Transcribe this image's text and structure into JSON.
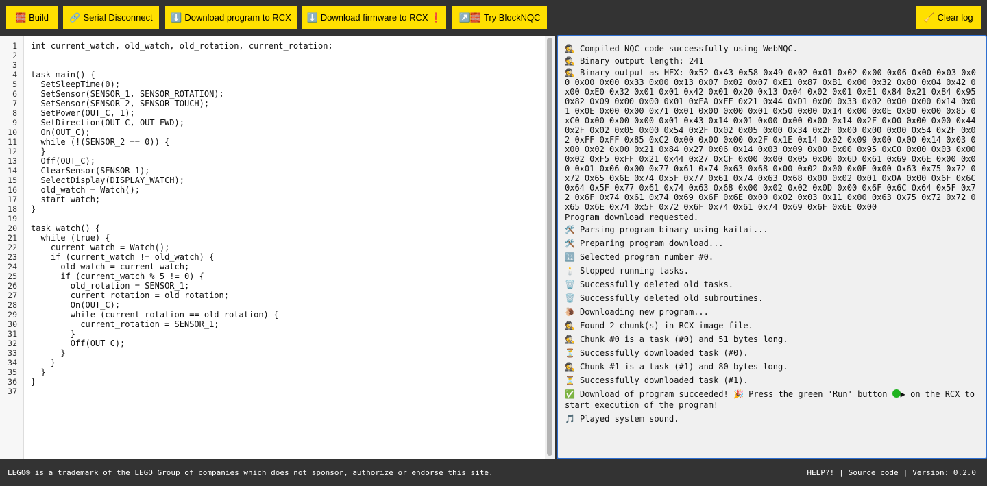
{
  "toolbar": {
    "build": {
      "icon": "🧱",
      "label": "Build"
    },
    "serial": {
      "icon": "🔗",
      "label": "Serial Disconnect"
    },
    "download_program": {
      "icon": "⬇️",
      "label": "Download program to RCX"
    },
    "download_firmware": {
      "icon": "⬇️",
      "label": "Download firmware to RCX ❗"
    },
    "try_blocknqc": {
      "icon": "↗️🧱",
      "label": "Try BlockNQC"
    },
    "clear_log": {
      "icon": "🧹",
      "label": "Clear log"
    },
    "button_color": "#ffe000"
  },
  "editor": {
    "line_numbers": [
      "1",
      "2",
      "3",
      "4",
      "5",
      "6",
      "7",
      "8",
      "9",
      "10",
      "11",
      "12",
      "13",
      "14",
      "15",
      "16",
      "17",
      "18",
      "19",
      "20",
      "21",
      "22",
      "23",
      "24",
      "25",
      "26",
      "27",
      "28",
      "29",
      "30",
      "31",
      "32",
      "33",
      "34",
      "35",
      "36",
      "37"
    ],
    "lines": [
      "int current_watch, old_watch, old_rotation, current_rotation;",
      "",
      "",
      "task main() {",
      "  SetSleepTime(0);",
      "  SetSensor(SENSOR_1, SENSOR_ROTATION);",
      "  SetSensor(SENSOR_2, SENSOR_TOUCH);",
      "  SetPower(OUT_C, 1);",
      "  SetDirection(OUT_C, OUT_FWD);",
      "  On(OUT_C);",
      "  while (!(SENSOR_2 == 0)) {",
      "  }",
      "  Off(OUT_C);",
      "  ClearSensor(SENSOR_1);",
      "  SelectDisplay(DISPLAY_WATCH);",
      "  old_watch = Watch();",
      "  start watch;",
      "}",
      "",
      "task watch() {",
      "  while (true) {",
      "    current_watch = Watch();",
      "    if (current_watch != old_watch) {",
      "      old_watch = current_watch;",
      "      if (current_watch % 5 != 0) {",
      "        old_rotation = SENSOR_1;",
      "        current_rotation = old_rotation;",
      "        On(OUT_C);",
      "        while (current_rotation == old_rotation) {",
      "          current_rotation = SENSOR_1;",
      "        }",
      "        Off(OUT_C);",
      "      }",
      "    }",
      "  }",
      "}",
      ""
    ]
  },
  "log": {
    "compiled": {
      "icon": "🕵️",
      "text": "Compiled NQC code successfully using WebNQC."
    },
    "binary_length": {
      "icon": "🕵️",
      "text": "Binary output length: 241"
    },
    "binary_hex": {
      "icon": "🕵️",
      "text": "Binary output as HEX: 0x52 0x43 0x58 0x49 0x02 0x01 0x02 0x00 0x06 0x00 0x03 0x00 0x00 0x00 0x33 0x00 0x13 0x07 0x02 0x07 0xE1 0x87 0xB1 0x00 0x32 0x00 0x04 0x42 0x00 0xE0 0x32 0x01 0x01 0x42 0x01 0x20 0x13 0x04 0x02 0x01 0xE1 0x84 0x21 0x84 0x95 0x82 0x09 0x00 0x00 0x01 0xFA 0xFF 0x21 0x44 0xD1 0x00 0x33 0x02 0x00 0x00 0x14 0x01 0x0E 0x00 0x00 0x71 0x01 0x00 0x00 0x01 0x50 0x00 0x14 0x00 0x0E 0x00 0x00 0x85 0xC0 0x00 0x00 0x00 0x01 0x43 0x14 0x01 0x00 0x00 0x00 0x14 0x2F 0x00 0x00 0x00 0x44 0x2F 0x02 0x05 0x00 0x54 0x2F 0x02 0x05 0x00 0x34 0x2F 0x00 0x00 0x00 0x54 0x2F 0x02 0xFF 0xFF 0x85 0xC2 0x00 0x00 0x00 0x2F 0x1E 0x14 0x02 0x09 0x00 0x00 0x14 0x03 0x00 0x02 0x00 0x21 0x84 0x27 0x06 0x14 0x03 0x09 0x00 0x00 0x95 0xC0 0x00 0x03 0x00 0x02 0xF5 0xFF 0x21 0x44 0x27 0xCF 0x00 0x00 0x05 0x00 0x6D 0x61 0x69 0x6E 0x00 0x00 0x01 0x06 0x00 0x77 0x61 0x74 0x63 0x68 0x00 0x02 0x00 0x0E 0x00 0x63 0x75 0x72 0x72 0x65 0x6E 0x74 0x5F 0x77 0x61 0x74 0x63 0x68 0x00 0x02 0x01 0x0A 0x00 0x6F 0x6C 0x64 0x5F 0x77 0x61 0x74 0x63 0x68 0x00 0x02 0x02 0x0D 0x00 0x6F 0x6C 0x64 0x5F 0x72 0x6F 0x74 0x61 0x74 0x69 0x6F 0x6E 0x00 0x02 0x03 0x11 0x00 0x63 0x75 0x72 0x72 0x65 0x6E 0x74 0x5F 0x72 0x6F 0x74 0x61 0x74 0x69 0x6F 0x6E 0x00"
    },
    "requested": {
      "text": "Program download requested."
    },
    "parsing": {
      "icon": "🛠️",
      "text": "Parsing program binary using kaitai..."
    },
    "preparing": {
      "icon": "🛠️",
      "text": "Preparing program download..."
    },
    "selected": {
      "icon": "🔢",
      "text": "Selected program number #0."
    },
    "stopped": {
      "icon": "🕯️",
      "text": "Stopped running tasks."
    },
    "deleted_tasks": {
      "icon": "🗑️",
      "text": "Successfully deleted old tasks."
    },
    "deleted_subs": {
      "icon": "🗑️",
      "text": "Successfully deleted old subroutines."
    },
    "downloading": {
      "icon": "🐌",
      "text": "Downloading new program..."
    },
    "found": {
      "icon": "🕵️",
      "text": "Found 2 chunk(s) in RCX image file."
    },
    "chunk0": {
      "icon": "🕵️",
      "text": "Chunk #0 is a task (#0) and 51 bytes long."
    },
    "dl0": {
      "icon": "⏳",
      "text": "Successfully downloaded task (#0)."
    },
    "chunk1": {
      "icon": "🕵️",
      "text": "Chunk #1 is a task (#1) and 80 bytes long."
    },
    "dl1": {
      "icon": "⏳",
      "text": "Successfully downloaded task (#1)."
    },
    "success": {
      "icon": "✅",
      "text_a": "Download of program succeeded! 🎉 Press the green 'Run' button ",
      "run_glyph": "▶",
      "text_b": " on the RCX to start execution of the program!"
    },
    "sound": {
      "icon": "🎵",
      "text": "Played system sound."
    }
  },
  "footer": {
    "notice": "LEGO® is a trademark of the LEGO Group of companies which does not sponsor, authorize or endorse this site.",
    "help": "HELP?!",
    "separator": "|",
    "source": "Source code",
    "version": "Version: 0.2.0"
  }
}
